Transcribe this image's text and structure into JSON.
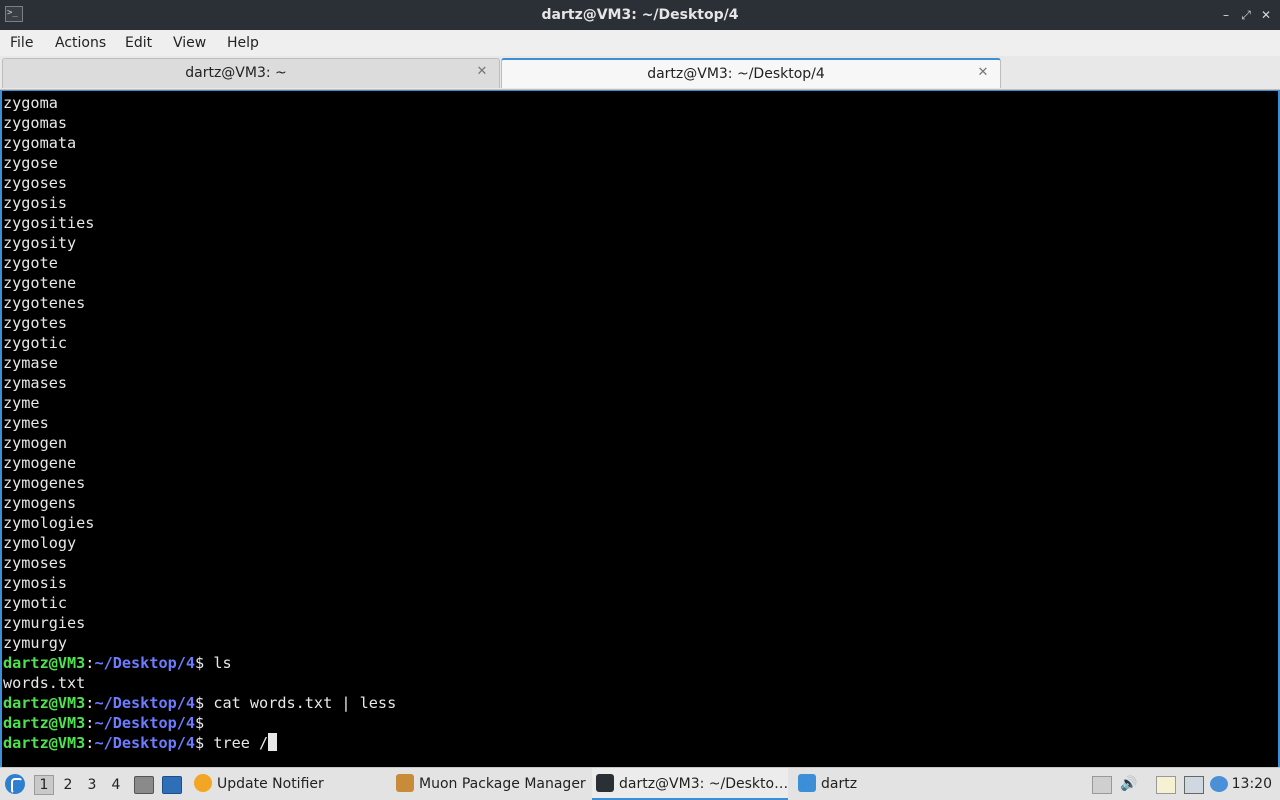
{
  "window": {
    "title": "dartz@VM3: ~/Desktop/4",
    "minimize": "–",
    "maximize": "⤢",
    "close": "✕"
  },
  "menu": [
    "File",
    "Actions",
    "Edit",
    "View",
    "Help"
  ],
  "tabs": [
    {
      "label": "dartz@VM3: ~",
      "active": false
    },
    {
      "label": "dartz@VM3: ~/Desktop/4",
      "active": true
    }
  ],
  "terminal": {
    "output_words": [
      "zygoma",
      "zygomas",
      "zygomata",
      "zygose",
      "zygoses",
      "zygosis",
      "zygosities",
      "zygosity",
      "zygote",
      "zygotene",
      "zygotenes",
      "zygotes",
      "zygotic",
      "zymase",
      "zymases",
      "zyme",
      "zymes",
      "zymogen",
      "zymogene",
      "zymogenes",
      "zymogens",
      "zymologies",
      "zymology",
      "zymoses",
      "zymosis",
      "zymotic",
      "zymurgies",
      "zymurgy"
    ],
    "prompt": {
      "user_host": "dartz@VM3",
      "colon": ":",
      "path": "~/Desktop/4",
      "symbol": "$ "
    },
    "history": [
      {
        "type": "prompt",
        "command": "ls"
      },
      {
        "type": "output",
        "text": "words.txt"
      },
      {
        "type": "prompt",
        "command": "cat words.txt | less"
      },
      {
        "type": "prompt",
        "command": ""
      },
      {
        "type": "prompt",
        "command": "tree /",
        "cursor": true
      }
    ]
  },
  "taskbar": {
    "workspaces": [
      "1",
      "2",
      "3",
      "4"
    ],
    "active_workspace": "1",
    "tasks": [
      {
        "label": "Update Notifier",
        "icon": "update-notifier-icon",
        "active": false
      },
      {
        "label": "Muon Package Manager",
        "icon": "package-manager-icon",
        "active": false
      },
      {
        "label": "dartz@VM3: ~/Deskto…",
        "icon": "terminal-icon",
        "active": true
      },
      {
        "label": "dartz",
        "icon": "folder-icon",
        "active": false
      }
    ],
    "clock": "13:20"
  },
  "colors": {
    "accent": "#3c8fd6",
    "prompt_user": "#4ee24e",
    "prompt_path": "#6d7cff",
    "terminal_bg": "#000000"
  }
}
